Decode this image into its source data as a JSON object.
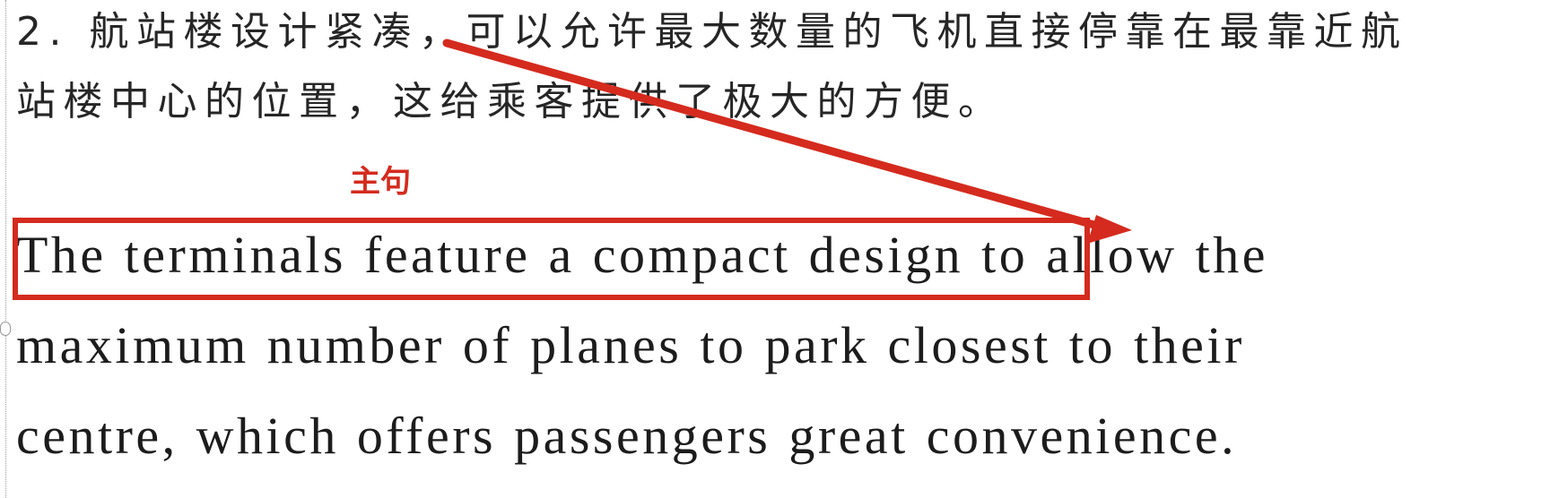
{
  "document": {
    "chinese_lines": [
      "2. 航站楼设计紧凑，可以允许最大数量的飞机直接停靠在最靠近航",
      "站楼中心的位置，这给乘客提供了极大的方便。"
    ],
    "english_lines": [
      "The terminals feature a compact design to allow the",
      "maximum number of planes to park closest to their",
      "centre, which offers passengers great convenience."
    ]
  },
  "annotation": {
    "label": "主句",
    "color": "#d42b1e"
  }
}
